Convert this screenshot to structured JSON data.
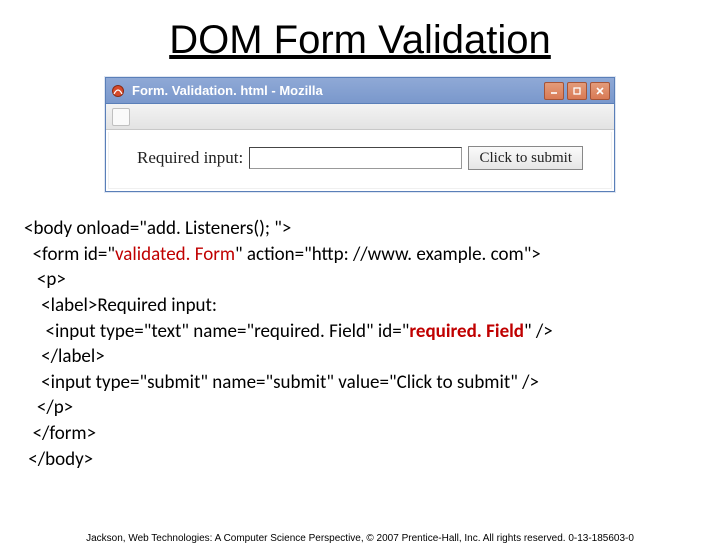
{
  "title": "DOM Form Validation",
  "window": {
    "titlebar_text": "Form. Validation. html - Mozilla",
    "icon": "mozilla-icon",
    "buttons": {
      "min": "-",
      "max": "□",
      "close": "×"
    }
  },
  "form": {
    "label": "Required input:",
    "input_value": "",
    "input_placeholder": "",
    "submit_label": "Click to submit"
  },
  "code": {
    "l1a": "<body onload=\"add. Listeners(); \">",
    "l2a": "  <form id=\"",
    "l2b": "validated. Form",
    "l2c": "\" action=\"http: //www. example. com\">",
    "l3": "   <p>",
    "l4": "    <label>Required input:",
    "l5a": "     <input type=\"text\" name=\"required. Field\" id=\"",
    "l5b": "required. Field",
    "l5c": "\" />",
    "l6": "    </label>",
    "l7": "    <input type=\"submit\" name=\"submit\" value=\"Click to submit\" />",
    "l8": "   </p>",
    "l9": "  </form>",
    "l10": " </body>"
  },
  "footer": "Jackson, Web Technologies: A Computer Science Perspective, © 2007 Prentice-Hall, Inc. All rights reserved. 0-13-185603-0"
}
